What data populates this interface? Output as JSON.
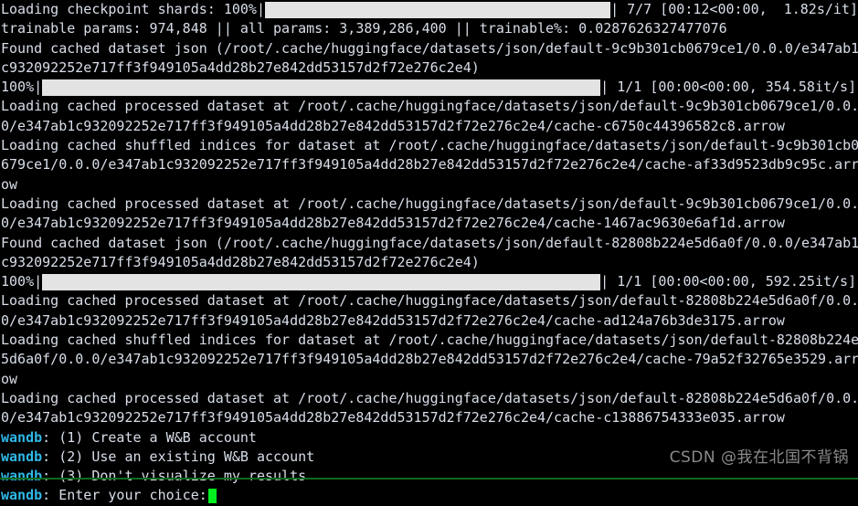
{
  "terminal": {
    "background_color": "#000000",
    "foreground_color": "#d8dee9",
    "accent_color": "#2fb8e8",
    "cursor_color": "#00f020",
    "progress_bar_color": "#e3e3e3",
    "bottom_rule_color": "#0f6b1f",
    "lines": [
      {
        "kind": "pbar",
        "prefix": "Loading checkpoint shards: 100%|",
        "fill_width": 479,
        "suffix": "| 7/7 [00:12<00:00,  1.82s/it]"
      },
      {
        "kind": "text",
        "text": "trainable params: 974,848 || all params: 3,389,286,400 || trainable%: 0.0287626327477076"
      },
      {
        "kind": "text",
        "text": "Found cached dataset json (/root/.cache/huggingface/datasets/json/default-9c9b301cb0679ce1/0.0.0/e347ab1"
      },
      {
        "kind": "text",
        "text": "c932092252e717ff3f949105a4dd28b27e842dd53157d2f72e276c2e4)"
      },
      {
        "kind": "pbar",
        "prefix": "100%|",
        "fill_width": 611,
        "suffix": "| 1/1 [00:00<00:00, 354.58it/s]"
      },
      {
        "kind": "text",
        "text": "Loading cached processed dataset at /root/.cache/huggingface/datasets/json/default-9c9b301cb0679ce1/0.0."
      },
      {
        "kind": "text",
        "text": "0/e347ab1c932092252e717ff3f949105a4dd28b27e842dd53157d2f72e276c2e4/cache-c6750c44396582c8.arrow"
      },
      {
        "kind": "text",
        "text": "Loading cached shuffled indices for dataset at /root/.cache/huggingface/datasets/json/default-9c9b301cb0"
      },
      {
        "kind": "text",
        "text": "679ce1/0.0.0/e347ab1c932092252e717ff3f949105a4dd28b27e842dd53157d2f72e276c2e4/cache-af33d9523db9c95c.arr"
      },
      {
        "kind": "text",
        "text": "ow"
      },
      {
        "kind": "text",
        "text": "Loading cached processed dataset at /root/.cache/huggingface/datasets/json/default-9c9b301cb0679ce1/0.0."
      },
      {
        "kind": "text",
        "text": "0/e347ab1c932092252e717ff3f949105a4dd28b27e842dd53157d2f72e276c2e4/cache-1467ac9630e6af1d.arrow"
      },
      {
        "kind": "text",
        "text": "Found cached dataset json (/root/.cache/huggingface/datasets/json/default-82808b224e5d6a0f/0.0.0/e347ab1"
      },
      {
        "kind": "text",
        "text": "c932092252e717ff3f949105a4dd28b27e842dd53157d2f72e276c2e4)"
      },
      {
        "kind": "pbar",
        "prefix": "100%|",
        "fill_width": 611,
        "suffix": "| 1/1 [00:00<00:00, 592.25it/s]"
      },
      {
        "kind": "text",
        "text": "Loading cached processed dataset at /root/.cache/huggingface/datasets/json/default-82808b224e5d6a0f/0.0."
      },
      {
        "kind": "text",
        "text": "0/e347ab1c932092252e717ff3f949105a4dd28b27e842dd53157d2f72e276c2e4/cache-ad124a76b3de3175.arrow"
      },
      {
        "kind": "text",
        "text": "Loading cached shuffled indices for dataset at /root/.cache/huggingface/datasets/json/default-82808b224e"
      },
      {
        "kind": "text",
        "text": "5d6a0f/0.0.0/e347ab1c932092252e717ff3f949105a4dd28b27e842dd53157d2f72e276c2e4/cache-79a52f32765e3529.arr"
      },
      {
        "kind": "text",
        "text": "ow"
      },
      {
        "kind": "text",
        "text": "Loading cached processed dataset at /root/.cache/huggingface/datasets/json/default-82808b224e5d6a0f/0.0."
      },
      {
        "kind": "text",
        "text": "0/e347ab1c932092252e717ff3f949105a4dd28b27e842dd53157d2f72e276c2e4/cache-c13886754333e035.arrow"
      },
      {
        "kind": "wandb",
        "tag": "wandb",
        "text": " (1) Create a W&B account"
      },
      {
        "kind": "wandb",
        "tag": "wandb",
        "text": " (2) Use an existing W&B account"
      },
      {
        "kind": "wandb",
        "tag": "wandb",
        "text": " (3) Don't visualize my results"
      },
      {
        "kind": "wandb",
        "tag": "wandb",
        "text": " Enter your choice:",
        "cursor": true
      }
    ]
  },
  "watermark": {
    "text": "CSDN @我在北国不背锅"
  }
}
